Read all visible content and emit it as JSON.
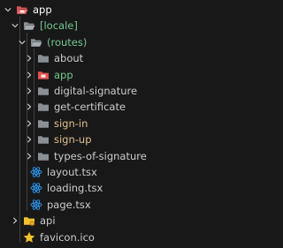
{
  "colors": {
    "background": "#181818",
    "default_text": "#cccccc",
    "green_text": "#73c991",
    "yellow_text": "#e2c08d",
    "folder_gray": "#8a8f96",
    "folder_green": "#56a95e",
    "folder_red": "#e05252",
    "react_blue": "#2e8fe0",
    "favicon_yellow": "#f2c12e"
  },
  "tree": {
    "items": [
      {
        "label": "app",
        "icon": "app-folder-open-icon",
        "chevron": "chevron-down-icon",
        "color": "#ffffff",
        "depth": 0
      },
      {
        "label": "[locale]",
        "icon": "folder-open-icon",
        "chevron": "chevron-down-icon",
        "color": "#73c991",
        "depth": 1
      },
      {
        "label": "(routes)",
        "icon": "folder-open-icon",
        "chevron": "chevron-down-icon",
        "color": "#73c991",
        "depth": 2
      },
      {
        "label": "about",
        "icon": "folder-icon",
        "chevron": "chevron-right-icon",
        "color": "#cccccc",
        "depth": 3
      },
      {
        "label": "app",
        "icon": "app-folder-icon",
        "chevron": "chevron-right-icon",
        "color": "#73c991",
        "depth": 3
      },
      {
        "label": "digital-signature",
        "icon": "folder-icon",
        "chevron": "chevron-right-icon",
        "color": "#cccccc",
        "depth": 3
      },
      {
        "label": "get-certificate",
        "icon": "folder-icon",
        "chevron": "chevron-right-icon",
        "color": "#cccccc",
        "depth": 3
      },
      {
        "label": "sign-in",
        "icon": "folder-icon",
        "chevron": "chevron-right-icon",
        "color": "#e2c08d",
        "depth": 3
      },
      {
        "label": "sign-up",
        "icon": "folder-icon",
        "chevron": "chevron-right-icon",
        "color": "#e2c08d",
        "depth": 3
      },
      {
        "label": "types-of-signature",
        "icon": "folder-icon",
        "chevron": "chevron-right-icon",
        "color": "#cccccc",
        "depth": 3
      },
      {
        "label": "layout.tsx",
        "icon": "react-icon",
        "chevron": "",
        "color": "#cccccc",
        "depth": 2
      },
      {
        "label": "loading.tsx",
        "icon": "react-icon",
        "chevron": "",
        "color": "#cccccc",
        "depth": 2
      },
      {
        "label": "page.tsx",
        "icon": "react-icon",
        "chevron": "",
        "color": "#cccccc",
        "depth": 2
      },
      {
        "label": "api",
        "icon": "api-folder-icon",
        "chevron": "chevron-right-icon",
        "color": "#cccccc",
        "depth": 1
      },
      {
        "label": "favicon.ico",
        "icon": "favicon-star-icon",
        "chevron": "",
        "color": "#cccccc",
        "depth": 1
      }
    ]
  }
}
